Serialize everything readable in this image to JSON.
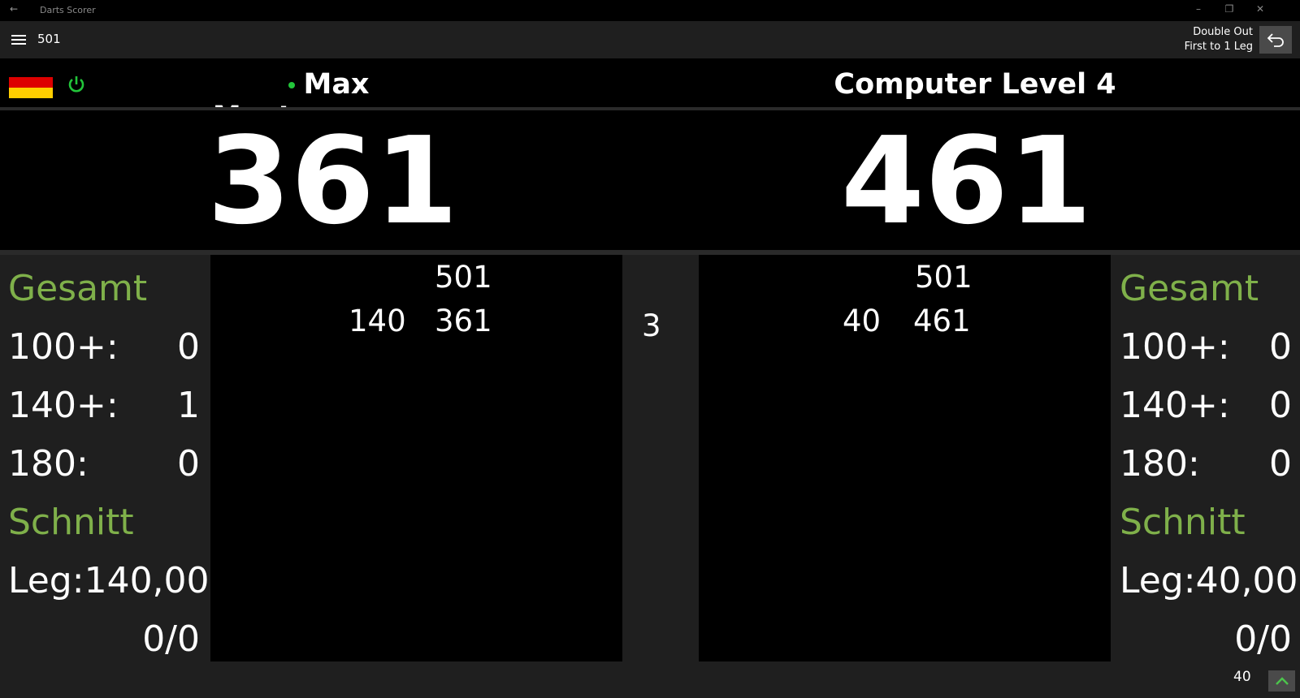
{
  "window": {
    "title": "Darts Scorer",
    "back_glyph": "←",
    "minimize_glyph": "–",
    "restore_glyph": "❐",
    "close_glyph": "✕"
  },
  "appbar": {
    "mode": "501",
    "rule_line1": "Double Out",
    "rule_line2": "First to 1 Leg",
    "undo_icon": "undo-icon"
  },
  "player1": {
    "name": "Max Mustermann",
    "score": "361",
    "flag_colors": [
      "#000000",
      "#dd0000",
      "#ffce00"
    ],
    "history": {
      "start": "501",
      "thrown": "140",
      "remaining": "361"
    },
    "stats": {
      "total_label": "Gesamt",
      "c100_label": "100+:",
      "c100": "0",
      "c140_label": "140+:",
      "c140": "1",
      "c180_label": "180:",
      "c180": "0",
      "avg_label": "Schnitt",
      "leg_label": "Leg:",
      "leg_avg": "140,00",
      "checkout": "0/0"
    }
  },
  "player2": {
    "name": "Computer Level 4",
    "score": "461",
    "history": {
      "start": "501",
      "thrown": "40",
      "remaining": "461"
    },
    "stats": {
      "total_label": "Gesamt",
      "c100_label": "100+:",
      "c100": "0",
      "c140_label": "140+:",
      "c140": "0",
      "c180_label": "180:",
      "c180": "0",
      "avg_label": "Schnitt",
      "leg_label": "Leg:",
      "leg_avg": "40,00",
      "checkout": "0/0"
    }
  },
  "round_number": "3",
  "footer": {
    "last_throw": "40"
  },
  "colors": {
    "active_dot": "#22c53a",
    "stat_header": "#7fb04a",
    "power": "#22c53a"
  }
}
